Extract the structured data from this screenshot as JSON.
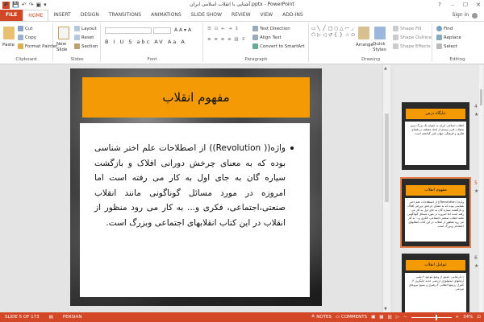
{
  "window": {
    "title": "آشنایی با انقلاب اسلامی ایران.pptx - PowerPoint",
    "app_icon": "P",
    "help": "?",
    "controls": [
      "–",
      "☐",
      "✕"
    ]
  },
  "quick_access": [
    "💾",
    "↶",
    "↷",
    "▣",
    "▾"
  ],
  "tabs": [
    "FILE",
    "HOME",
    "INSERT",
    "DESIGN",
    "TRANSITIONS",
    "ANIMATIONS",
    "SLIDE SHOW",
    "REVIEW",
    "VIEW",
    "ADD-INS"
  ],
  "active_tab": "HOME",
  "signin": "Sign in",
  "ribbon": {
    "clipboard": {
      "title": "Clipboard",
      "paste": "Paste",
      "cut": "Cut",
      "copy": "Copy",
      "format_painter": "Format Painter"
    },
    "slides": {
      "title": "Slides",
      "new_slide": "New Slide",
      "layout": "Layout",
      "reset": "Reset",
      "section": "Section"
    },
    "font": {
      "title": "Font",
      "font_name": "",
      "font_size": "",
      "row1": "A A ▾ A",
      "row2": "B I U S abc AV Aa A"
    },
    "paragraph": {
      "title": "Paragraph",
      "text_direction": "Text Direction",
      "align_text": "Align Text",
      "convert_smartart": "Convert to SmartArt"
    },
    "drawing": {
      "title": "Drawing",
      "arrange": "Arrange",
      "quick_styles": "Quick Styles",
      "shape_fill": "Shape Fill",
      "shape_outline": "Shape Outline",
      "shape_effects": "Shape Effects",
      "shapes": [
        "▭",
        "╲",
        "╱",
        "□",
        "○",
        "△",
        "⌐",
        "⌟",
        "⬠",
        "▷",
        "◁",
        "↺",
        "{",
        "}",
        "☆",
        "⬭"
      ]
    },
    "editing": {
      "title": "Editing",
      "find": "Find",
      "replace": "Replace",
      "select": "Select"
    }
  },
  "slide": {
    "title": "مفهوم انقلاب",
    "body": "واژه(( Revolution)) از اصطلاحات علم اختر شناسی بوده که به معنای چرخش دورانی افلاک و بازگشت سیاره گان به جای اول به کار می رفته است اما امروزه در مورد مسائل گوناگونی مانند انقلاب صنعتی،اجتماعی، فکری و... به کار می رود منظور از انقلاب در این کتاب انقلابهای اجتماعی وبزرگ است."
  },
  "thumbnails": [
    {
      "num": "4",
      "title": "جایگاه درس",
      "body": "انقلاب اسلامی ایران به عنوان یک بزرگ ترین تحولات قرن بیستم از ابعاد مختلف در فضای فکری و فرهنگی جهان تاثیر گذاشته است.",
      "selected": false
    },
    {
      "num": "5",
      "title": "مفهوم انقلاب",
      "body": "واژه(( Revolution)) از اصطلاحات علم اختر شناسی بوده که به معنای چرخش دورانی افلاک و بازگشت سیاره گان به جای اول به کار می رفته است اما امروزه در مورد مسائل گوناگونی مانند انقلاب صنعتی،اجتماعی، فکری و... به کار می رود منظور از انقلاب در این کتاب انقلابهای اجتماعی وبزرگ است.",
      "selected": true
    },
    {
      "num": "6",
      "title": "عوامل انقلاب",
      "body": "۱-نارضایتی عمیق از وضع موجود ۲-تغییر آرمانهای ایدئولوژی ارزشی جدید جایگزین ۳-کنترل رژیمها انقلابی ۴-رهبری و بسیج نیروهای مردمی",
      "selected": false
    }
  ],
  "status": {
    "slide_info": "SLIDE 5 OF 173",
    "language": "PERSIAN",
    "notes": "NOTES",
    "comments": "COMMENTS",
    "zoom": "34%"
  },
  "colors": {
    "accent": "#d24726",
    "slide_title_bg": "#f39a05"
  }
}
